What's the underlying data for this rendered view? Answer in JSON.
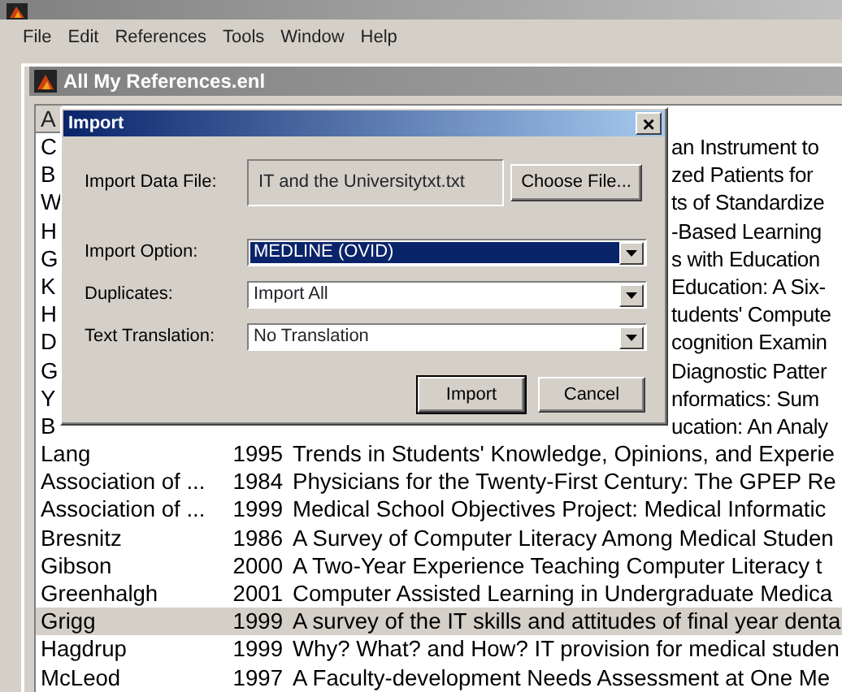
{
  "app": {
    "menu": [
      "File",
      "Edit",
      "References",
      "Tools",
      "Window",
      "Help"
    ]
  },
  "document": {
    "title": "All My References.enl",
    "header": "A",
    "rows": [
      {
        "kind": "covered",
        "author": "C",
        "title": "an Instrument to"
      },
      {
        "kind": "covered",
        "author": "B",
        "title": "zed Patients for"
      },
      {
        "kind": "covered",
        "author": "W",
        "title": "ts of Standardize"
      },
      {
        "kind": "covered",
        "author": "H",
        "title": "-Based Learning"
      },
      {
        "kind": "covered",
        "author": "G",
        "title": "s with Education"
      },
      {
        "kind": "covered",
        "author": "K",
        "title": "Education: A Six-"
      },
      {
        "kind": "covered",
        "author": "H",
        "title": "tudents' Compute"
      },
      {
        "kind": "covered",
        "author": "D",
        "title": "cognition Examin"
      },
      {
        "kind": "covered",
        "author": "G",
        "title": "Diagnostic Patter"
      },
      {
        "kind": "covered",
        "author": "Y",
        "title": "nformatics: Sum"
      },
      {
        "kind": "covered",
        "author": "B",
        "title": "ucation: An Analy"
      },
      {
        "kind": "full",
        "author": "Lang",
        "year": "1995",
        "title": "Trends in Students' Knowledge, Opinions, and Experie",
        "selected": false
      },
      {
        "kind": "full",
        "author": "Association of ...",
        "year": "1984",
        "title": "Physicians for the Twenty-First Century: The GPEP Re",
        "selected": false
      },
      {
        "kind": "full",
        "author": "Association of ...",
        "year": "1999",
        "title": "Medical School Objectives Project: Medical Informatic",
        "selected": false
      },
      {
        "kind": "full",
        "author": "Bresnitz",
        "year": "1986",
        "title": "A Survey of Computer Literacy Among Medical Studen",
        "selected": false
      },
      {
        "kind": "full",
        "author": "Gibson",
        "year": "2000",
        "title": "A Two-Year Experience Teaching Computer Literacy t",
        "selected": false
      },
      {
        "kind": "full",
        "author": "Greenhalgh",
        "year": "2001",
        "title": "Computer Assisted Learning in Undergraduate Medica",
        "selected": false
      },
      {
        "kind": "full",
        "author": "Grigg",
        "year": "1999",
        "title": "A survey of the IT skills and attitudes of final year denta",
        "selected": true
      },
      {
        "kind": "full",
        "author": "Hagdrup",
        "year": "1999",
        "title": "Why? What? and How? IT provision for medical studen",
        "selected": false
      },
      {
        "kind": "full",
        "author": "McLeod",
        "year": "1997",
        "title": "A Faculty-development Needs Assessment at One Me",
        "selected": false
      }
    ]
  },
  "dialog": {
    "title": "Import",
    "close": "×",
    "file": {
      "label": "Import Data File:",
      "value": "IT and the Universitytxt.txt",
      "button": "Choose File..."
    },
    "selects": [
      {
        "label": "Import Option:",
        "value": "MEDLINE (OVID)",
        "focused": true
      },
      {
        "label": "Duplicates:",
        "value": "Import All",
        "focused": false
      },
      {
        "label": "Text Translation:",
        "value": "No Translation",
        "focused": false
      }
    ],
    "buttons": [
      {
        "label": "Import",
        "default": true
      },
      {
        "label": "Cancel",
        "default": false
      }
    ]
  }
}
